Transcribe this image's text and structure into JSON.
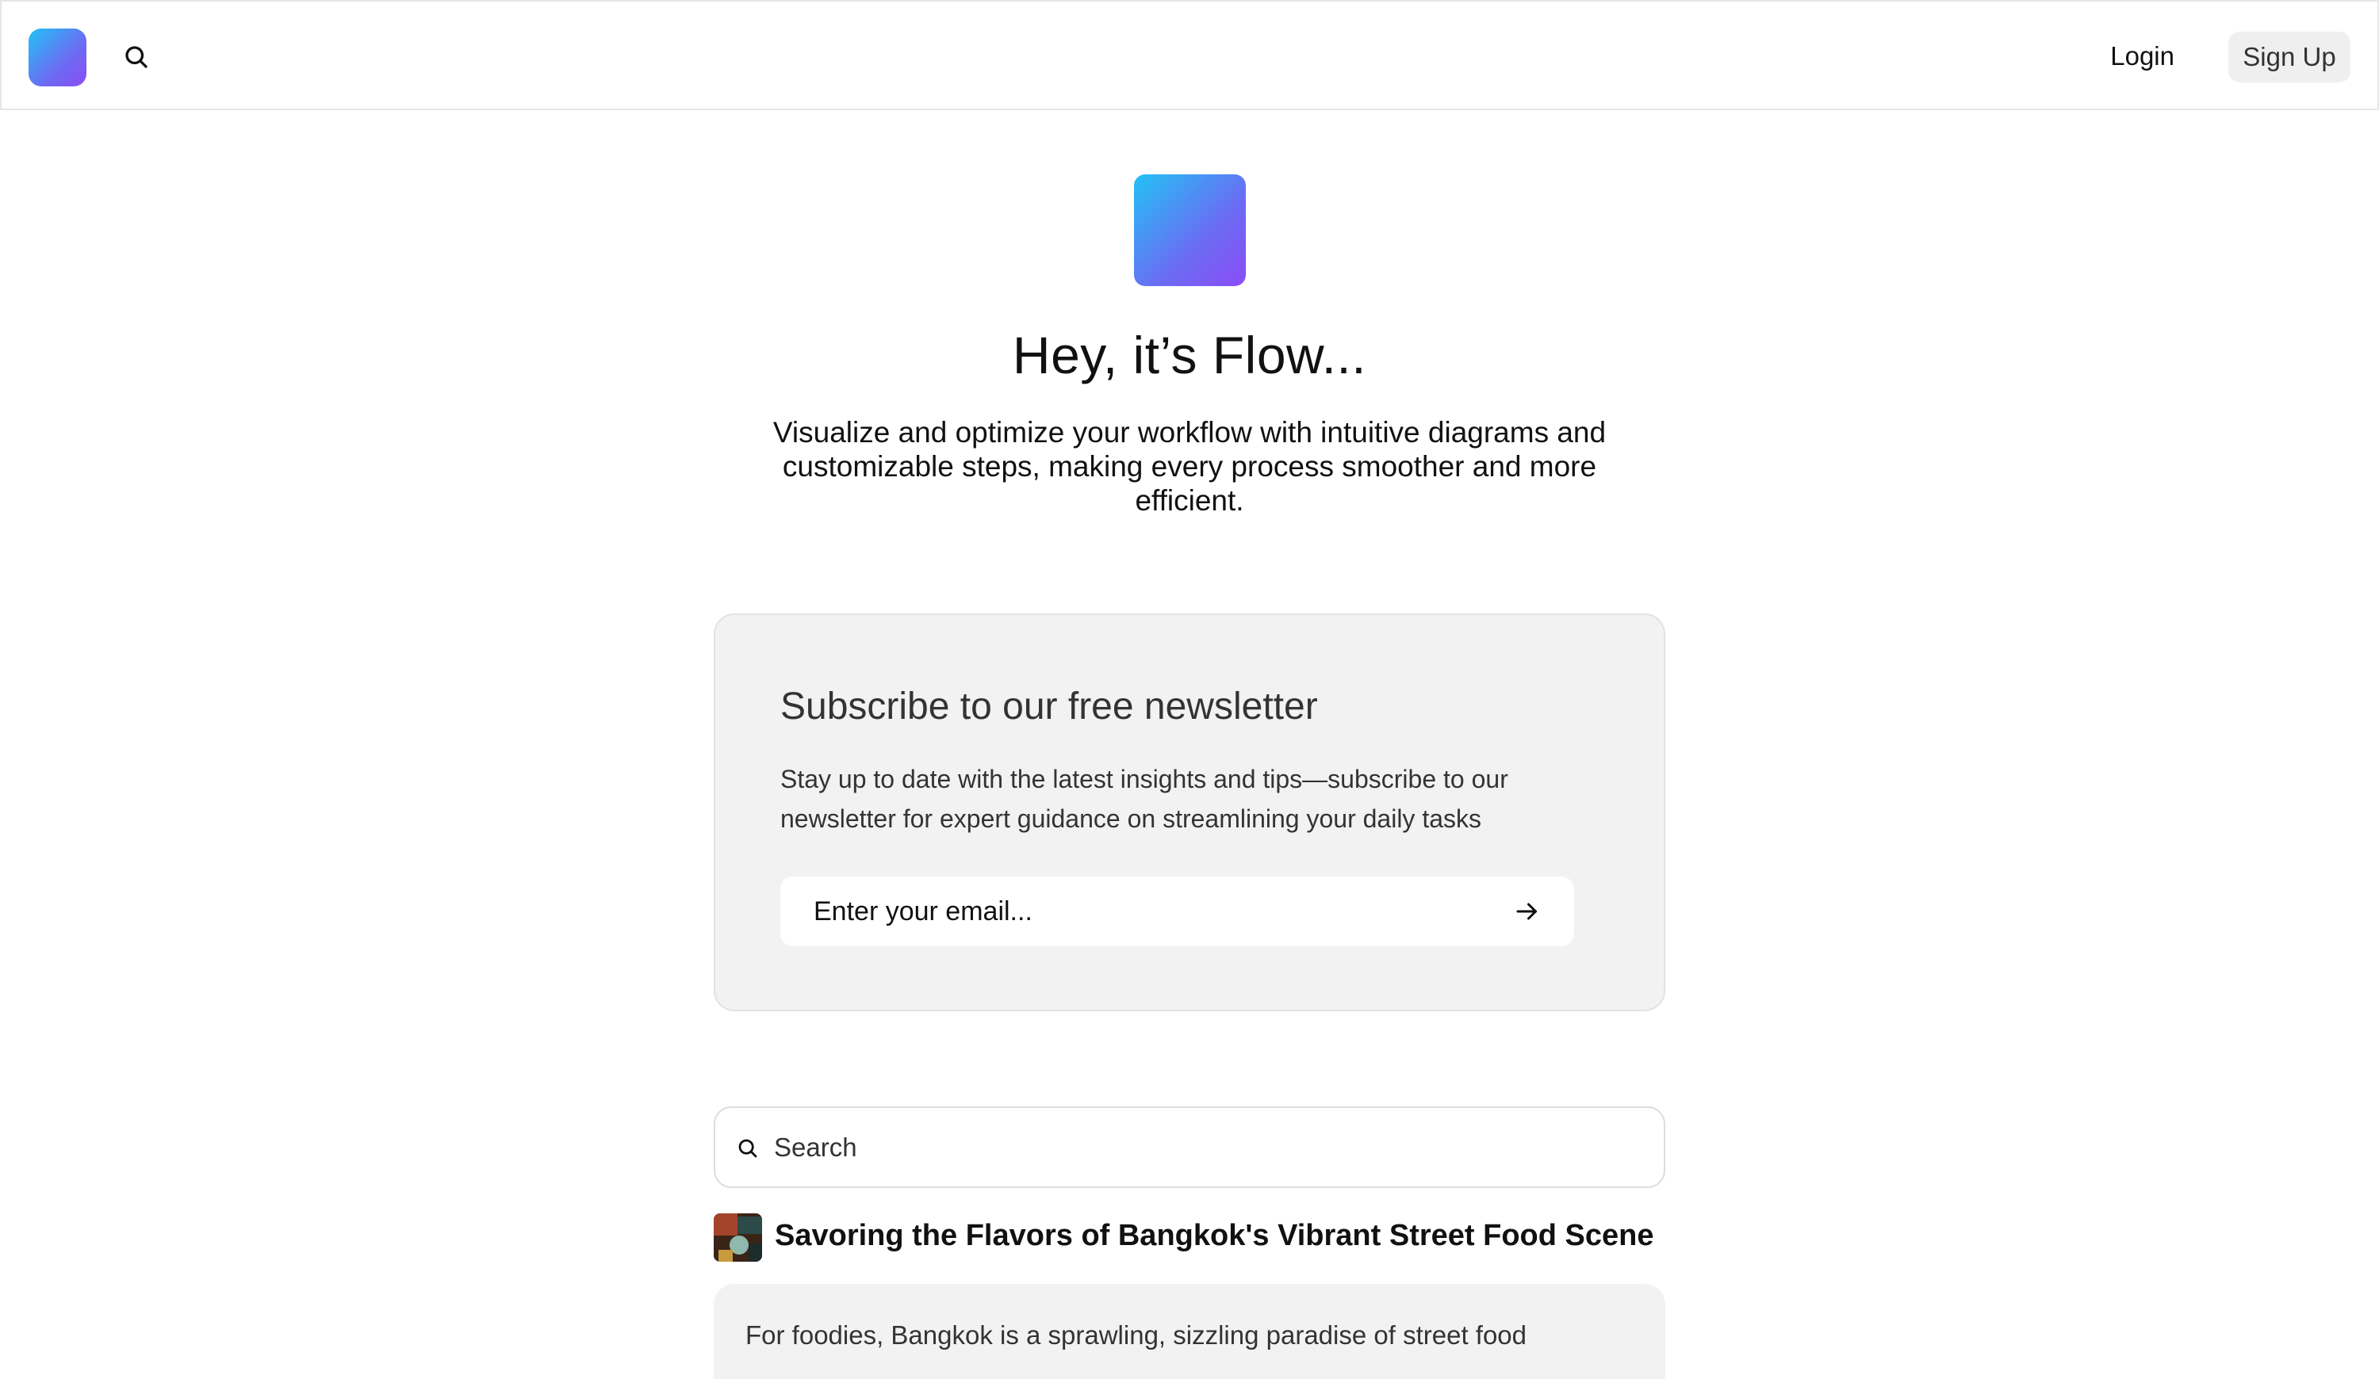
{
  "colors": {
    "brand_gradient_start": "#22c2f5",
    "brand_gradient_end": "#8b4cf5",
    "card_background": "#f2f2f2",
    "text_primary": "#111111"
  },
  "nav": {
    "login_label": "Login",
    "signup_label": "Sign Up",
    "icons": [
      "app-logo",
      "search-icon"
    ]
  },
  "hero": {
    "title": "Hey, it’s Flow...",
    "description": "Visualize and optimize your workflow with intuitive diagrams and customizable steps, making every process smoother and more efficient."
  },
  "newsletter": {
    "title": "Subscribe to our free newsletter",
    "description": "Stay up to date with the latest insights and tips—subscribe to our newsletter for expert guidance on streamlining your daily tasks",
    "email_placeholder": "Enter your email...",
    "submit_icon": "arrow-right-icon"
  },
  "search": {
    "placeholder": "Search",
    "icon": "search-icon"
  },
  "posts": [
    {
      "title": "Savoring the Flavors of Bangkok's Vibrant Street Food Scene",
      "excerpt": "For foodies, Bangkok is a sprawling, sizzling paradise of street food"
    }
  ]
}
